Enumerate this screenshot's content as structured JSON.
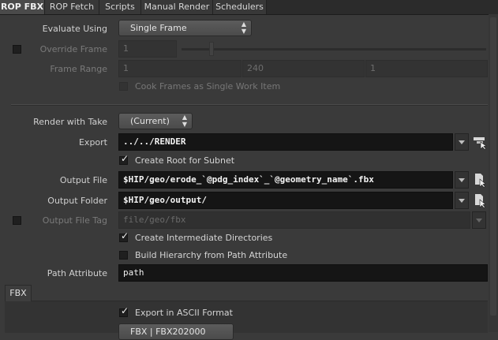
{
  "tabs": [
    {
      "label": "ROP FBX",
      "active": true
    },
    {
      "label": "ROP Fetch"
    },
    {
      "label": "Scripts"
    },
    {
      "label": "Manual Render"
    },
    {
      "label": "Schedulers"
    }
  ],
  "evaluate": {
    "label": "Evaluate Using",
    "value": "Single Frame"
  },
  "override_frame": {
    "label": "Override Frame",
    "value": "1"
  },
  "frame_range": {
    "label": "Frame Range",
    "start": "1",
    "end": "240",
    "inc": "1"
  },
  "cook_frames": {
    "label": "Cook Frames as Single Work Item"
  },
  "render_take": {
    "label": "Render with Take",
    "value": "(Current)"
  },
  "export": {
    "label": "Export",
    "value": "../../RENDER"
  },
  "create_root": {
    "label": "Create Root for Subnet",
    "checked": true
  },
  "output_file": {
    "label": "Output File",
    "value": "$HIP/geo/erode_`@pdg_index`_`@geometry_name`.fbx"
  },
  "output_folder": {
    "label": "Output Folder",
    "value": "$HIP/geo/output/"
  },
  "output_file_tag": {
    "label": "Output File Tag",
    "placeholder": "file/geo/fbx"
  },
  "create_dirs": {
    "label": "Create Intermediate Directories",
    "checked": true
  },
  "build_hierarchy": {
    "label": "Build Hierarchy from Path Attribute",
    "checked": false
  },
  "path_attr": {
    "label": "Path Attribute",
    "value": "path"
  },
  "fbx_tab": {
    "label": "FBX"
  },
  "ascii": {
    "label": "Export in ASCII Format",
    "checked": true
  },
  "sdk_menu": {
    "value": "FBX | FBX202000"
  },
  "icons": {
    "node_picker": "node-picker-icon",
    "file_chooser": "file-chooser-icon"
  }
}
